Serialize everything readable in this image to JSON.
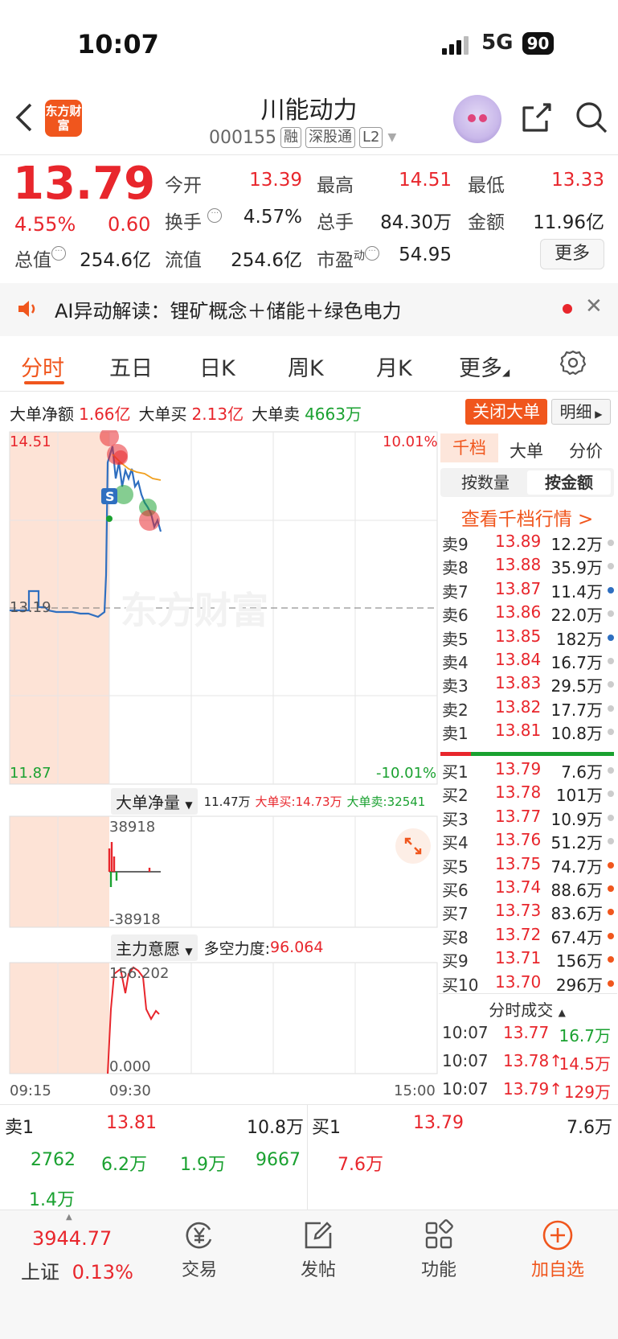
{
  "status_bar": {
    "time": "10:07",
    "network": "5G",
    "battery": "90"
  },
  "header": {
    "logo_text": "东方财富",
    "stock_name": "川能动力",
    "stock_code": "000155",
    "tags": [
      "融",
      "深股通",
      "L2"
    ]
  },
  "quote": {
    "price": "13.79",
    "change_pct": "4.55%",
    "change_amt": "0.60",
    "open_label": "今开",
    "open": "13.39",
    "high_label": "最高",
    "high": "14.51",
    "low_label": "最低",
    "low": "13.33",
    "turnover_label": "换手",
    "turnover": "4.57%",
    "volume_label": "总手",
    "volume": "84.30万",
    "amount_label": "金额",
    "amount": "11.96亿",
    "mcap_label": "总值",
    "mcap": "254.6亿",
    "float_label": "流值",
    "float_cap": "254.6亿",
    "pe_label": "市盈",
    "pe_sup": "动",
    "pe": "54.95",
    "more_label": "更多"
  },
  "ai_banner": {
    "text": "AI异动解读：锂矿概念＋储能＋绿色电力"
  },
  "tabs": [
    "分时",
    "五日",
    "日K",
    "周K",
    "月K",
    "更多"
  ],
  "big_orders": {
    "net_label": "大单净额",
    "net": "1.66亿",
    "buy_label": "大单买",
    "buy": "2.13亿",
    "sell_label": "大单卖",
    "sell": "4663万",
    "close_btn": "关闭大单",
    "detail_btn": "明细"
  },
  "chart": {
    "top_price": "14.51",
    "top_pct": "10.01%",
    "ref_price": "13.19",
    "bottom_price": "11.87",
    "bottom_pct": "-10.01%",
    "watermark": "东方财富",
    "sub1_title": "大单净量",
    "sub1_value": "11.47万",
    "sub1_buy": "大单买:14.73万",
    "sub1_sell": "大单卖:32541",
    "sub1_top": "38918",
    "sub1_bottom": "-38918",
    "sub2_title": "主力意愿",
    "sub2_label": "多空力度:",
    "sub2_value": "96.064",
    "sub2_top": "156.202",
    "sub2_bottom": "0.000",
    "time_start": "09:15",
    "time_open": "09:30",
    "time_end": "15:00"
  },
  "order_book": {
    "tabs": [
      "千档",
      "大单",
      "分价"
    ],
    "modes": [
      "按数量",
      "按金额"
    ],
    "link": "查看千档行情 >",
    "asks": [
      {
        "label": "卖9",
        "price": "13.89",
        "vol": "12.2万"
      },
      {
        "label": "卖8",
        "price": "13.88",
        "vol": "35.9万"
      },
      {
        "label": "卖7",
        "price": "13.87",
        "vol": "11.4万"
      },
      {
        "label": "卖6",
        "price": "13.86",
        "vol": "22.0万"
      },
      {
        "label": "卖5",
        "price": "13.85",
        "vol": "182万"
      },
      {
        "label": "卖4",
        "price": "13.84",
        "vol": "16.7万"
      },
      {
        "label": "卖3",
        "price": "13.83",
        "vol": "29.5万"
      },
      {
        "label": "卖2",
        "price": "13.82",
        "vol": "17.7万"
      },
      {
        "label": "卖1",
        "price": "13.81",
        "vol": "10.8万"
      }
    ],
    "bids": [
      {
        "label": "买1",
        "price": "13.79",
        "vol": "7.6万"
      },
      {
        "label": "买2",
        "price": "13.78",
        "vol": "101万"
      },
      {
        "label": "买3",
        "price": "13.77",
        "vol": "10.9万"
      },
      {
        "label": "买4",
        "price": "13.76",
        "vol": "51.2万"
      },
      {
        "label": "买5",
        "price": "13.75",
        "vol": "74.7万"
      },
      {
        "label": "买6",
        "price": "13.74",
        "vol": "88.6万"
      },
      {
        "label": "买7",
        "price": "13.73",
        "vol": "83.6万"
      },
      {
        "label": "买8",
        "price": "13.72",
        "vol": "67.4万"
      },
      {
        "label": "买9",
        "price": "13.71",
        "vol": "156万"
      },
      {
        "label": "买10",
        "price": "13.70",
        "vol": "296万"
      }
    ],
    "ticks_title": "分时成交",
    "ticks": [
      {
        "time": "10:07",
        "price": "13.77",
        "vol": "16.7万"
      },
      {
        "time": "10:07",
        "price": "13.78↑",
        "vol": "14.5万"
      },
      {
        "time": "10:07",
        "price": "13.79↑",
        "vol": "129万"
      }
    ]
  },
  "bottom_quote": {
    "sell_label": "卖1",
    "sell_price": "13.81",
    "sell_vol": "10.8万",
    "buy_label": "买1",
    "buy_price": "13.79",
    "buy_vol": "7.6万",
    "sell_breakdown": [
      "2762",
      "6.2万",
      "1.9万",
      "9667",
      "1.4万"
    ],
    "buy_breakdown": [
      "7.6万"
    ]
  },
  "bottom_nav": {
    "index_value": "3944.77",
    "index_name": "上证",
    "index_pct": "0.13%",
    "items": [
      "交易",
      "发帖",
      "功能",
      "加自选"
    ]
  },
  "colors": {
    "up": "#e8262c",
    "down": "#1aa130",
    "accent": "#f0561d",
    "line": "#2f6fc0",
    "avg": "#f0a020"
  }
}
